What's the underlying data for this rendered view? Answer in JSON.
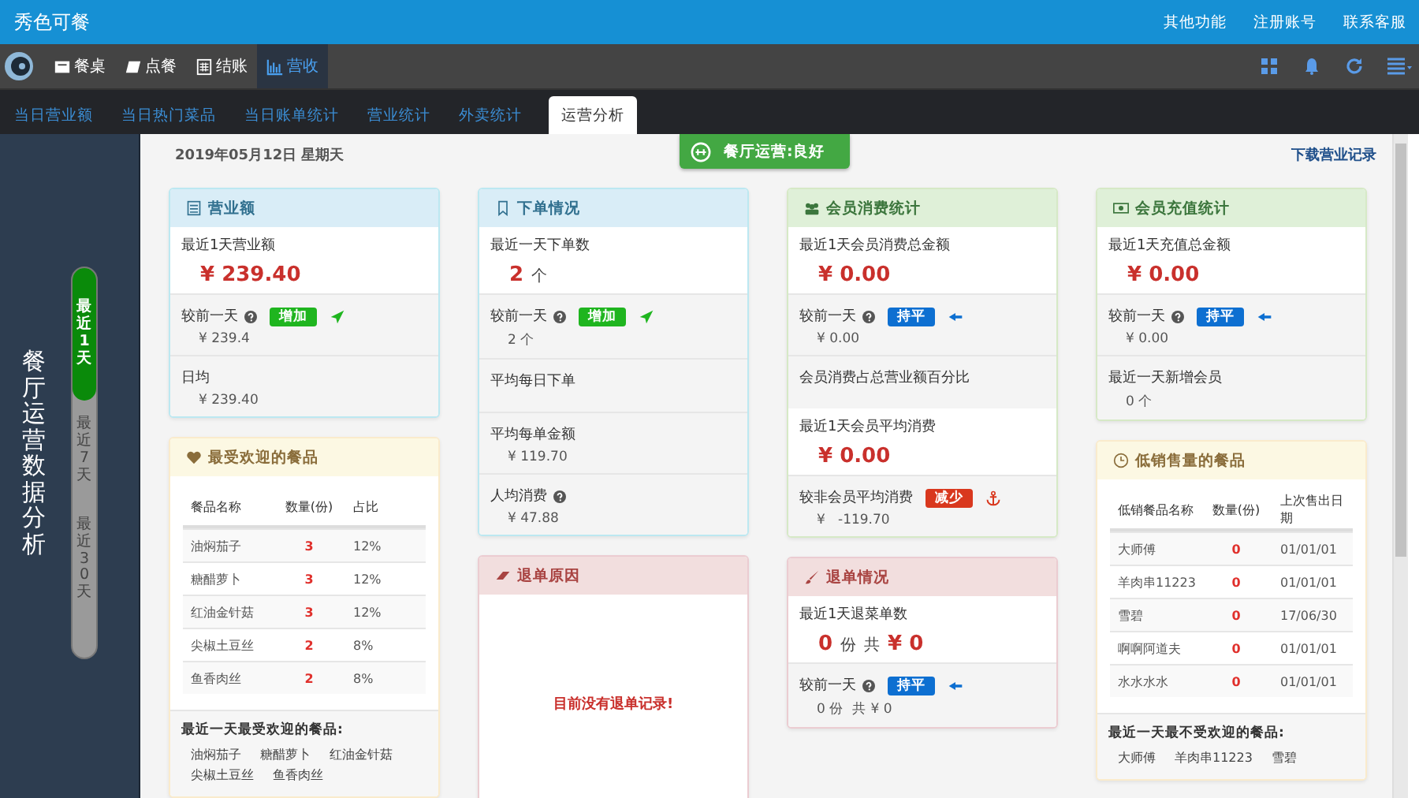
{
  "app_title": "秀色可餐",
  "top_links": [
    "其他功能",
    "注册账号",
    "联系客服"
  ],
  "toolbar": [
    {
      "label": "餐桌",
      "selected": false
    },
    {
      "label": "点餐",
      "selected": false
    },
    {
      "label": "结账",
      "selected": false
    },
    {
      "label": "营收",
      "selected": true
    }
  ],
  "tabs": [
    {
      "label": "当日营业额",
      "selected": false
    },
    {
      "label": "当日热门菜品",
      "selected": false
    },
    {
      "label": "当日账单统计",
      "selected": false
    },
    {
      "label": "营业统计",
      "selected": false
    },
    {
      "label": "外卖统计",
      "selected": false
    },
    {
      "label": "运营分析",
      "selected": true
    }
  ],
  "sidebar": {
    "title": "餐厅运营数据分析",
    "ranges": [
      {
        "label": "最近1天",
        "selected": true
      },
      {
        "label": "最近7天",
        "selected": false
      },
      {
        "label": "最近30天",
        "selected": false
      }
    ]
  },
  "date": "2019年05月12日 星期天",
  "status": "餐厅运营:良好",
  "download": "下载营业记录",
  "columns": [
    {
      "cards": [
        {
          "title": "营业额",
          "kind": "info",
          "sections": [
            {
              "kind": "metric",
              "label": "最近1天营业额",
              "parts": [
                {
                  "text": "¥ 239.40",
                  "em": true
                }
              ]
            },
            {
              "kind": "stat",
              "label": "较前一天",
              "help": true,
              "badge": {
                "text": "增加",
                "kind": "up"
              },
              "value": "¥ 239.4"
            },
            {
              "kind": "stat",
              "label": "日均",
              "help": false,
              "value": "¥ 239.40"
            }
          ]
        },
        {
          "title": "最受欢迎的餐品",
          "kind": "warning",
          "sections": [
            {
              "kind": "table",
              "columns": [
                "餐品名称",
                "数量(份)",
                "占比"
              ],
              "rows": [
                [
                  "油焖茄子",
                  "3",
                  "12%"
                ],
                [
                  "糖醋萝卜",
                  "3",
                  "12%"
                ],
                [
                  "红油金针菇",
                  "3",
                  "12%"
                ],
                [
                  "尖椒土豆丝",
                  "2",
                  "8%"
                ],
                [
                  "鱼香肉丝",
                  "2",
                  "8%"
                ]
              ]
            },
            {
              "kind": "tags",
              "label": "最近一天最受欢迎的餐品:",
              "items": [
                "油焖茄子",
                "糖醋萝卜",
                "红油金针菇",
                "尖椒土豆丝",
                "鱼香肉丝"
              ]
            }
          ]
        }
      ]
    },
    {
      "cards": [
        {
          "title": "下单情况",
          "kind": "info",
          "sections": [
            {
              "kind": "metric",
              "label": "最近一天下单数",
              "parts": [
                {
                  "text": "2",
                  "em": true
                },
                {
                  "text": "个",
                  "em": false
                }
              ]
            },
            {
              "kind": "stat",
              "label": "较前一天",
              "help": true,
              "badge": {
                "text": "增加",
                "kind": "up"
              },
              "value": "2 个"
            },
            {
              "kind": "stat",
              "label": "平均每日下单",
              "help": false
            },
            {
              "kind": "stat",
              "label": "平均每单金额",
              "help": false,
              "value": "¥ 119.70"
            },
            {
              "kind": "stat",
              "label": "人均消费",
              "help": true,
              "value": "¥ 47.88"
            }
          ]
        },
        {
          "title": "退单原因",
          "kind": "danger",
          "sections": [
            {
              "kind": "empty",
              "text": "目前没有退单记录!"
            }
          ]
        }
      ]
    },
    {
      "cards": [
        {
          "title": "会员消费统计",
          "kind": "success",
          "sections": [
            {
              "kind": "metric",
              "label": "最近1天会员消费总金额",
              "parts": [
                {
                  "text": "¥ 0.00",
                  "em": true
                }
              ]
            },
            {
              "kind": "stat",
              "label": "较前一天",
              "help": true,
              "badge": {
                "text": "持平",
                "kind": "flat"
              },
              "value": "¥ 0.00"
            },
            {
              "kind": "stat",
              "label": "会员消费占总营业额百分比",
              "help": false
            },
            {
              "kind": "metric",
              "label": "最近1天会员平均消费",
              "parts": [
                {
                  "text": "¥ 0.00",
                  "em": true
                }
              ]
            },
            {
              "kind": "stat",
              "label": "较非会员平均消费",
              "help": false,
              "badge": {
                "text": "减少",
                "kind": "down"
              },
              "value": "¥   -119.70"
            }
          ]
        },
        {
          "title": "退单情况",
          "kind": "danger",
          "sections": [
            {
              "kind": "metric",
              "label": "最近1天退菜单数",
              "parts": [
                {
                  "text": "0",
                  "em": true
                },
                {
                  "text": "份",
                  "em": false
                },
                {
                  "text": "共",
                  "em": false
                },
                {
                  "text": "¥ 0",
                  "em": true
                }
              ]
            },
            {
              "kind": "stat",
              "label": "较前一天",
              "help": true,
              "badge": {
                "text": "持平",
                "kind": "flat"
              },
              "value": "0 份  共 ¥ 0"
            }
          ]
        }
      ]
    },
    {
      "cards": [
        {
          "title": "会员充值统计",
          "kind": "success",
          "sections": [
            {
              "kind": "metric",
              "label": "最近1天充值总金额",
              "parts": [
                {
                  "text": "¥ 0.00",
                  "em": true
                }
              ]
            },
            {
              "kind": "stat",
              "label": "较前一天",
              "help": true,
              "badge": {
                "text": "持平",
                "kind": "flat"
              },
              "value": "¥ 0.00"
            },
            {
              "kind": "stat",
              "label": "最近一天新增会员",
              "help": false,
              "value": "0 个"
            }
          ]
        },
        {
          "title": "低销售量的餐品",
          "kind": "warning",
          "sections": [
            {
              "kind": "table",
              "columns": [
                "低销餐品名称",
                "数量(份)",
                "上次售出日期"
              ],
              "rows": [
                [
                  "大师傅",
                  "0",
                  "01/01/01"
                ],
                [
                  "羊肉串11223",
                  "0",
                  "01/01/01"
                ],
                [
                  "雪碧",
                  "0",
                  "17/06/30"
                ],
                [
                  "啊啊阿道夫",
                  "0",
                  "01/01/01"
                ],
                [
                  "水水水水",
                  "0",
                  "01/01/01"
                ]
              ]
            },
            {
              "kind": "tags",
              "label": "最近一天最不受欢迎的餐品:",
              "items": [
                "大师傅",
                "羊肉串11223",
                "雪碧"
              ]
            }
          ]
        }
      ]
    }
  ]
}
